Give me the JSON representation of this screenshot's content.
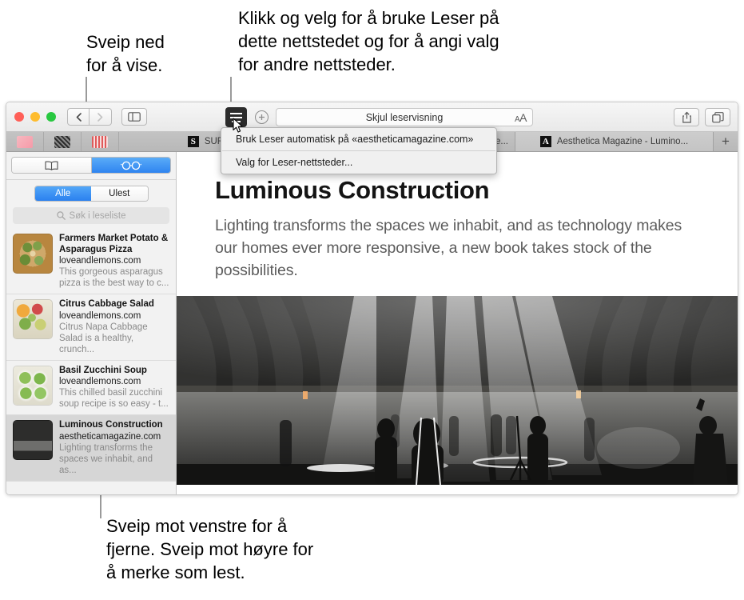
{
  "callouts": {
    "top_left": "Sveip ned\nfor å vise.",
    "top_right": "Klikk og velg for å bruke Leser på\ndette nettstedet og for å angi valg\nfor andre nettsteder.",
    "bottom": "Sveip mot venstre for å\nfjerne. Sveip mot høyre for\nå merke som lest."
  },
  "window": {
    "toolbar": {
      "back_icon": "chevron-left-icon",
      "forward_icon": "chevron-right-icon",
      "sidebar_icon": "sidebar-icon",
      "reader_icon": "reader-icon",
      "add_bookmark_icon": "plus-circle-icon",
      "address_text": "Skjul leservisning",
      "text_size_small": "A",
      "text_size_big": "A",
      "share_icon": "share-icon",
      "show_tabs_icon": "tab-overview-icon"
    },
    "favorites": [
      {
        "name": "favorite-pink"
      },
      {
        "name": "favorite-dark"
      },
      {
        "name": "favorite-red"
      }
    ],
    "tabs": [
      {
        "label": "SURFACE",
        "icon_letter": "S",
        "active": false
      },
      {
        "label": "hromatic Expe...",
        "icon_letter": "",
        "active": false
      },
      {
        "label": "Aesthetica Magazine - Lumino...",
        "icon_letter": "A",
        "active": true
      }
    ],
    "new_tab_label": "+"
  },
  "sidebar": {
    "top_segment": [
      {
        "name": "bookmarks-tab",
        "icon": "book-icon",
        "selected": false
      },
      {
        "name": "reading-list-tab",
        "icon": "glasses-icon",
        "selected": true
      }
    ],
    "filter_segment": [
      {
        "label": "Alle",
        "selected": true
      },
      {
        "label": "Ulest",
        "selected": false
      }
    ],
    "search": {
      "icon": "search-icon",
      "placeholder": "Søk i leseliste"
    },
    "items": [
      {
        "title": "Farmers Market Potato & Asparagus Pizza",
        "url": "loveandlemons.com",
        "snippet": "This gorgeous asparagus pizza is the best way to c...",
        "selected": false,
        "thumb": "pizza"
      },
      {
        "title": "Citrus Cabbage Salad",
        "url": "loveandlemons.com",
        "snippet": "Citrus Napa Cabbage Salad is a healthy, crunch...",
        "selected": false,
        "thumb": "salad"
      },
      {
        "title": "Basil Zucchini Soup",
        "url": "loveandlemons.com",
        "snippet": "This chilled basil zucchini soup recipe is so easy - t...",
        "selected": false,
        "thumb": "soup"
      },
      {
        "title": "Luminous Construction",
        "url": "aestheticamagazine.com",
        "snippet": "Lighting transforms the spaces we inhabit, and as...",
        "selected": true,
        "thumb": "installation"
      }
    ]
  },
  "article": {
    "title": "Luminous Construction",
    "subtitle": "Lighting transforms the spaces we inhabit, and as technology makes our homes ever more responsive, a new book takes stock of the possibilities.",
    "hero_alt": "light-installation-photo"
  },
  "menu": {
    "items": [
      {
        "label": "Bruk Leser automatisk på «aestheticamagazine.com»"
      },
      {
        "label": "Valg for Leser-nettsteder..."
      }
    ]
  },
  "colors": {
    "accent_blue": "#2a80ef",
    "window_chrome": "#ececec",
    "tabbar": "#bdbdbd",
    "selected_row": "#d6d6d6"
  }
}
